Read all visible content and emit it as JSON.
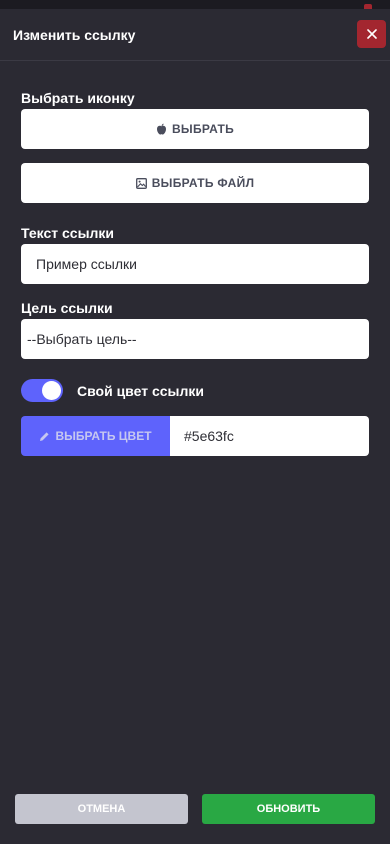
{
  "modal": {
    "title": "Изменить ссылку",
    "close_icon": "close-icon"
  },
  "icon_section": {
    "label": "Выбрать иконку",
    "choose_button": "ВЫБРАТЬ",
    "choose_icon": "apple-icon",
    "file_button": "ВЫБРАТЬ ФАЙЛ",
    "file_icon": "image-icon"
  },
  "link_text": {
    "label": "Текст ссылки",
    "value": "Пример ссылки"
  },
  "link_target": {
    "label": "Цель ссылки",
    "value": "--Выбрать цель--"
  },
  "custom_color": {
    "toggle_on": true,
    "label": "Свой цвет ссылки",
    "pick_button": "ВЫБРАТЬ ЦВЕТ",
    "pick_icon": "pencil-icon",
    "value": "#5e63fc"
  },
  "footer": {
    "cancel_label": "ОТМЕНА",
    "update_label": "ОБНОВИТЬ"
  },
  "colors": {
    "accent": "#5e63fc",
    "danger": "#a3262f",
    "success": "#29a844",
    "background": "#2b2a33"
  }
}
